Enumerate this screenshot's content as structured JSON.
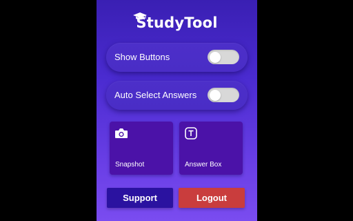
{
  "brand": {
    "name": "StudyTool",
    "icon": "graduation-cap-icon"
  },
  "toggles": [
    {
      "label": "Show Buttons",
      "on": false
    },
    {
      "label": "Auto Select Answers",
      "on": false
    }
  ],
  "tiles": [
    {
      "label": "Snapshot",
      "icon": "camera-icon"
    },
    {
      "label": "Answer Box",
      "icon": "text-box-icon"
    }
  ],
  "buttons": {
    "support": {
      "label": "Support",
      "color": "#2a12a0"
    },
    "logout": {
      "label": "Logout",
      "color": "#c93d3d"
    }
  },
  "colors": {
    "background_top": "#3a1fb3",
    "background_bottom": "#7a4cf0",
    "tile": "#4b12a8",
    "switch_track": "#d8d8d8"
  }
}
